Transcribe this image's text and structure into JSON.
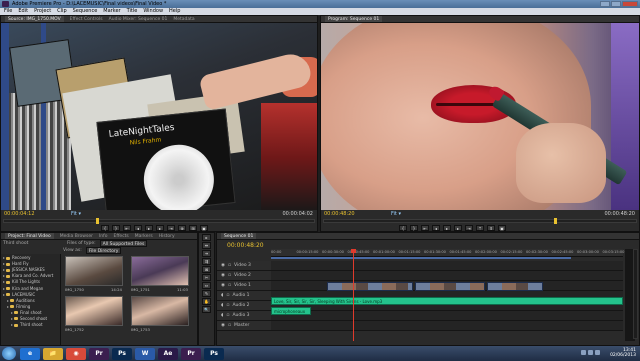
{
  "window": {
    "title": "Adobe Premiere Pro - D:\\LACEMUSIC\\Final videos\\Final Video *"
  },
  "menu": [
    "File",
    "Edit",
    "Project",
    "Clip",
    "Sequence",
    "Marker",
    "Title",
    "Window",
    "Help"
  ],
  "source_monitor": {
    "tabs": [
      "Source: IMG_1750.MOV",
      "Effect Controls",
      "Audio Mixer: Sequence 01",
      "Metadata"
    ],
    "cover_title": "LateNightTales",
    "cover_subtitle": "Nils Frahm",
    "timecode_current": "00:00:04:12",
    "timecode_duration": "00:00:04:02"
  },
  "program_monitor": {
    "tabs": [
      "Program: Sequence 01"
    ],
    "timecode_current": "00:00:48:20",
    "timecode_duration": "00:00:48:20"
  },
  "project_panel": {
    "tabs": [
      "Project: Final Video",
      "Media Browser",
      "Info",
      "Effects",
      "Markers",
      "History"
    ],
    "files_label": "Files of type:",
    "files_value": "All Supported Files",
    "view_label": "View as:",
    "view_value": "File Directory",
    "tree_header": "Third shoot",
    "tree": [
      {
        "label": "Recovery",
        "depth": 0
      },
      {
        "label": "Hard Fly",
        "depth": 0
      },
      {
        "label": "JESSICA NASKES",
        "depth": 0
      },
      {
        "label": "Kiara and Co. Advert",
        "depth": 0
      },
      {
        "label": "Kill The Lights",
        "depth": 0
      },
      {
        "label": "Kira and Megan",
        "depth": 0
      },
      {
        "label": "LACEMUSIC",
        "depth": 0
      },
      {
        "label": "Auditions",
        "depth": 1
      },
      {
        "label": "Filming",
        "depth": 1
      },
      {
        "label": "Final shoot",
        "depth": 2
      },
      {
        "label": "Second shoot",
        "depth": 2
      },
      {
        "label": "Third shoot",
        "depth": 2
      }
    ],
    "thumbs": [
      {
        "name": "IMG_1750",
        "dur": "14:24"
      },
      {
        "name": "IMG_1751",
        "dur": "11:03"
      },
      {
        "name": "IMG_1752",
        "dur": ""
      },
      {
        "name": "IMG_1753",
        "dur": ""
      }
    ]
  },
  "tools": [
    "▸",
    "⇹",
    "⇸",
    "⇶",
    "⊠",
    "✂",
    "⇔",
    "✎",
    "✋",
    "🔍"
  ],
  "timeline": {
    "tab": "Sequence 01",
    "timecode": "00:00:48:20",
    "ruler": [
      "00:00",
      "00:00:15:00",
      "00:00:30:00",
      "00:00:45:00",
      "00:01:00:00",
      "00:01:15:00",
      "00:01:30:00",
      "00:01:45:00",
      "00:02:00:00",
      "00:02:15:00",
      "00:02:30:00",
      "00:02:45:00",
      "00:03:00:00",
      "00:03:15:00"
    ],
    "tracks": [
      {
        "name": "Video 3",
        "kind": "video"
      },
      {
        "name": "Video 2",
        "kind": "video"
      },
      {
        "name": "Video 1",
        "kind": "video"
      },
      {
        "name": "Audio 1",
        "kind": "audio"
      },
      {
        "name": "Audio 2",
        "kind": "audio"
      },
      {
        "name": "Audio 3",
        "kind": "audio"
      },
      {
        "name": "Master",
        "kind": "master"
      }
    ],
    "audio_clip_1": "Love, Sir, Sir, Sir, Sir, Sleeping With Sirens - Love.mp3",
    "audio_clip_2": "microphoneaux"
  },
  "taskbar": {
    "apps": [
      "e",
      "📁",
      "◉",
      "Pr",
      "Ps",
      "W",
      "Ae",
      "Pr",
      "Ps"
    ],
    "time": "13:41",
    "date": "02/06/2013"
  },
  "colors": {
    "accent_timecode": "#e8c130",
    "audio_clip": "#24c38c",
    "playhead": "#e03a2c"
  }
}
